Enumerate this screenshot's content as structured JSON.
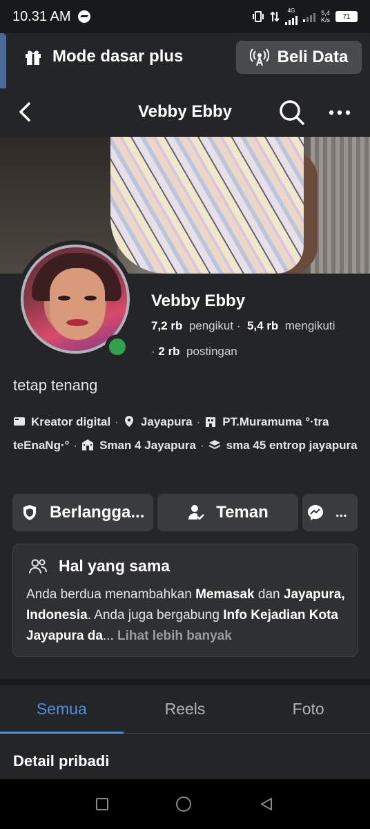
{
  "status_bar": {
    "time": "10.31 AM",
    "network": "4G",
    "net_speed_value": "5,4",
    "net_speed_unit": "K/s",
    "battery": "71"
  },
  "mode_bar": {
    "mode_label": "Mode dasar plus",
    "buy_data_label": "Beli Data"
  },
  "header": {
    "title": "Vebby Ebby"
  },
  "profile": {
    "name": "Vebby Ebby",
    "followers_count": "7,2 rb",
    "followers_label": "pengikut",
    "following_count": "5,4 rb",
    "following_label": "mengikuti",
    "posts_count": "2 rb",
    "posts_label": "postingan",
    "bio": "tetap tenang",
    "details": {
      "creator": "Kreator digital",
      "location": "Jayapura",
      "work": "PT.Muramuma °·tra teEnaNg·°",
      "school": "Sman 4 Jayapura",
      "education": "sma 45 entrop jayapura"
    }
  },
  "actions": {
    "subscribe_label": "Berlangga...",
    "friends_label": "Teman",
    "message_label": "..."
  },
  "common": {
    "title": "Hal yang sama",
    "text_1": "Anda berdua menambahkan ",
    "bold_1": "Memasak",
    "text_2": " dan ",
    "bold_2": "Jayapura, Indonesia",
    "text_3": ". Anda juga bergabung ",
    "bold_3": "Info Kejadian Kota Jayapura da",
    "text_4": "... ",
    "see_more": "Lihat lebih banyak"
  },
  "tabs": [
    {
      "label": "Semua",
      "active": true
    },
    {
      "label": "Reels",
      "active": false
    },
    {
      "label": "Foto",
      "active": false
    }
  ],
  "section": {
    "title": "Detail pribadi"
  },
  "colors": {
    "accent": "#4d8fe0",
    "online": "#31a24c",
    "background": "#242526"
  }
}
